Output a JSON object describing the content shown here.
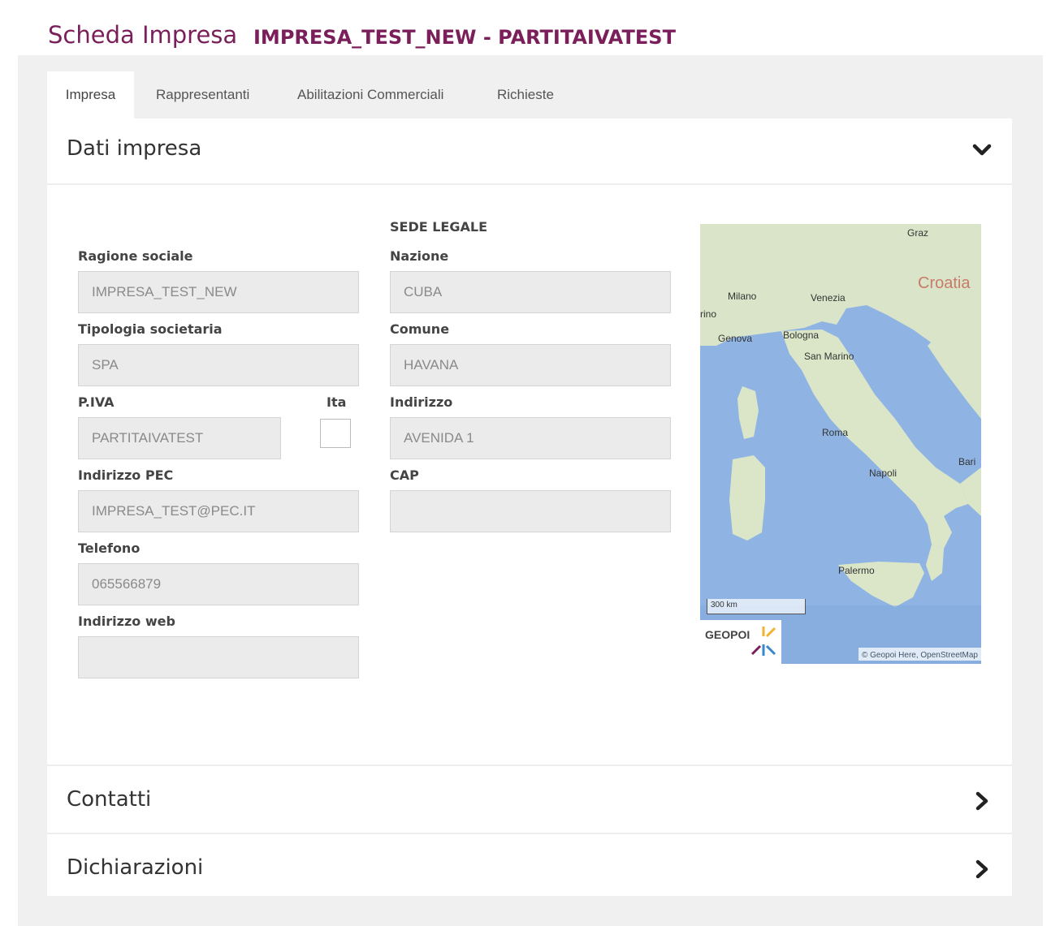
{
  "header": {
    "title": "Scheda Impresa",
    "subtitle": "IMPRESA_TEST_NEW - PARTITAIVATEST"
  },
  "tabs": [
    {
      "label": "Impresa",
      "active": true
    },
    {
      "label": "Rappresentanti",
      "active": false
    },
    {
      "label": "Abilitazioni Commerciali",
      "active": false
    },
    {
      "label": "Richieste",
      "active": false
    }
  ],
  "sections": {
    "dati_impresa": "Dati impresa",
    "contatti": "Contatti",
    "dichiarazioni": "Dichiarazioni"
  },
  "left_form": {
    "ragione_sociale": {
      "label": "Ragione sociale",
      "value": "IMPRESA_TEST_NEW"
    },
    "tipologia": {
      "label": "Tipologia societaria",
      "value": "SPA"
    },
    "piva": {
      "label": "P.IVA",
      "value": "PARTITAIVATEST"
    },
    "ita_label": "Ita",
    "pec": {
      "label": "Indirizzo PEC",
      "value": "IMPRESA_TEST@PEC.IT"
    },
    "telefono": {
      "label": "Telefono",
      "value": "065566879"
    },
    "web": {
      "label": "Indirizzo web",
      "value": ""
    }
  },
  "sede_legale": {
    "heading": "SEDE LEGALE",
    "nazione": {
      "label": "Nazione",
      "value": "CUBA"
    },
    "comune": {
      "label": "Comune",
      "value": "HAVANA"
    },
    "indirizzo": {
      "label": "Indirizzo",
      "value": "AVENIDA 1"
    },
    "cap": {
      "label": "CAP",
      "value": ""
    }
  },
  "map": {
    "places": {
      "graz": "Graz",
      "croatia": "Croatia",
      "milano": "Milano",
      "venezia": "Venezia",
      "torino": "rino",
      "genova": "Genova",
      "bologna": "Bologna",
      "san_marino": "San Marino",
      "roma": "Roma",
      "napoli": "Napoli",
      "bari": "Bari",
      "palermo": "Palermo"
    },
    "scale": "300 km",
    "logo": "GEOPOI",
    "attribution": "© Geopoi Here, OpenStreetMap"
  },
  "colors": {
    "brand": "#7a1f5a",
    "input_bg": "#ebebeb",
    "page_bg": "#f0f0f0",
    "sea": "#8fb4e3",
    "land": "#d9e4c8"
  },
  "icons": {
    "dati_impresa_chevron": "chevron-down-icon",
    "contatti_chevron": "chevron-right-icon",
    "dichiarazioni_chevron": "chevron-right-icon"
  }
}
